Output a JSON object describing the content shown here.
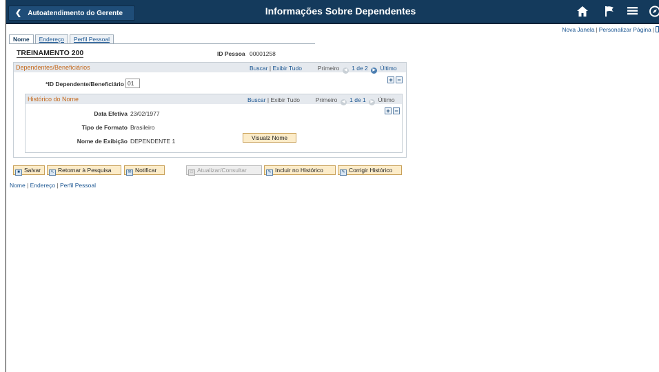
{
  "header": {
    "back_label": "Autoatendimento do Gerente",
    "title": "Informações Sobre Dependentes"
  },
  "icons": {
    "back": "chevron-left-icon",
    "home": "home-icon",
    "flag": "flag-icon",
    "menu": "hamburger-menu-icon",
    "nav": "navbar-compass-icon",
    "prev": "arrow-left-icon",
    "next": "arrow-right-icon",
    "add": "plus-icon",
    "remove": "minus-icon"
  },
  "util_links": {
    "new_window": "Nova Janela",
    "personalize": "Personalizar Página"
  },
  "tabs": [
    {
      "label": "Nome",
      "active": true
    },
    {
      "label": "Endereço",
      "active": false
    },
    {
      "label": "Perfil Pessoal",
      "active": false
    }
  ],
  "employee": {
    "name": "TREINAMENTO 200",
    "id_label": "ID Pessoa",
    "id_value": "00001258"
  },
  "dependents": {
    "title": "Dependentes/Beneficiários",
    "search": "Buscar",
    "view_all": "Exibir Tudo",
    "first": "Primeiro",
    "counter": "1 de 2",
    "last": "Último",
    "id_label": "*ID Dependente/Beneficiário",
    "id_value": "01"
  },
  "name_history": {
    "title": "Histórico do Nome",
    "search": "Buscar",
    "view_all": "Exibir Tudo",
    "first": "Primeiro",
    "counter": "1 de 1",
    "last": "Último",
    "effective_date_label": "Data Efetiva",
    "effective_date_value": "23/02/1977",
    "format_type_label": "Tipo de Formato",
    "format_type_value": "Brasileiro",
    "display_name_label": "Nome de Exibição",
    "display_name_value": "DEPENDENTE 1",
    "view_name_button": "Visualz Nome"
  },
  "toolbar": {
    "save": "Salvar",
    "return_search": "Retornar à Pesquisa",
    "notify": "Notificar",
    "update_display": "Atualizar/Consultar",
    "include_history": "Incluir no Histórico",
    "correct_history": "Corrigir Histórico"
  },
  "bottom_links": {
    "name": "Nome",
    "address": "Endereço",
    "profile": "Perfil Pessoal"
  }
}
